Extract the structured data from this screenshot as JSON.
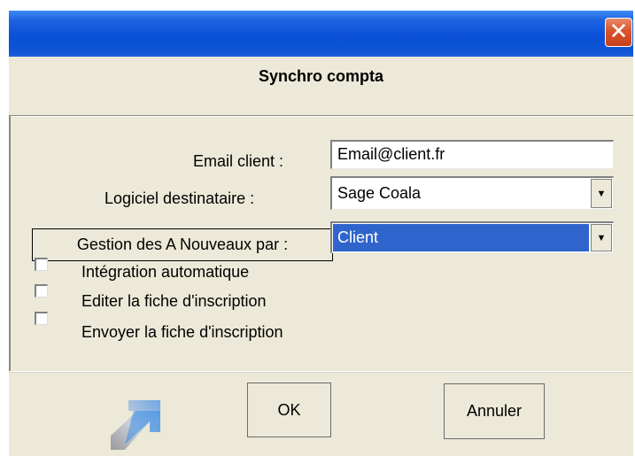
{
  "window": {
    "close_glyph": "✕"
  },
  "dialog": {
    "title": "Synchro compta"
  },
  "form": {
    "email_label": "Email client :",
    "email_value": "Email@client.fr",
    "software_label": "Logiciel destinataire :",
    "software_value": "Sage Coala",
    "management_label": "Gestion des A Nouveaux par :",
    "management_value": "Client",
    "dropdown_arrow": "▼"
  },
  "options": [
    {
      "label": "Intégration automatique",
      "checked": false
    },
    {
      "label": "Editer la fiche d'inscription",
      "checked": false
    },
    {
      "label": "Envoyer la fiche d'inscription",
      "checked": false
    }
  ],
  "buttons": {
    "ok": "OK",
    "cancel": "Annuler"
  },
  "icons": {
    "app": "arrow-up-right-icon",
    "close": "close-icon"
  },
  "colors": {
    "selection": "#2e64cb",
    "titlebar": "#0a50d8",
    "close": "#d9542c",
    "background": "#ece9d8"
  }
}
